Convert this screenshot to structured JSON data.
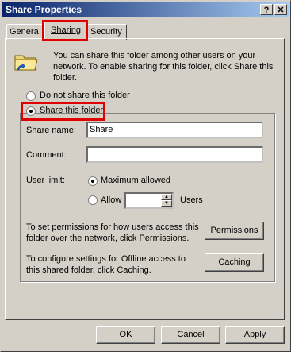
{
  "window": {
    "title": "Share Properties",
    "help_label": "?",
    "close_label": "✕"
  },
  "tabs": [
    {
      "label": "General",
      "visible_label": "Genera"
    },
    {
      "label": "Sharing"
    },
    {
      "label": "Security"
    }
  ],
  "info_text": "You can share this folder among other users on your network. To enable sharing for this folder, click Share this folder.",
  "sharing_options": {
    "do_not_share": {
      "label": "Do not share this folder",
      "selected": false
    },
    "share": {
      "label": "Share this folder",
      "selected": true
    }
  },
  "share_name": {
    "label": "Share name:",
    "value": "Share"
  },
  "comment": {
    "label": "Comment:",
    "value": ""
  },
  "user_limit": {
    "label": "User limit:",
    "maximum": {
      "label": "Maximum allowed",
      "selected": true
    },
    "allow": {
      "label": "Allow",
      "selected": false,
      "value": "",
      "unit": "Users"
    }
  },
  "permissions": {
    "text": "To set permissions for how users access this folder over the network, click Permissions.",
    "button": "Permissions"
  },
  "caching": {
    "text": "To configure settings for Offline access to this shared folder, click Caching.",
    "button": "Caching"
  },
  "footer": {
    "ok": "OK",
    "cancel": "Cancel",
    "apply": "Apply"
  },
  "colors": {
    "titlebar_start": "#0a246a",
    "titlebar_end": "#a6caf0",
    "face": "#d4d0c8",
    "highlight_box": "#e00000"
  }
}
